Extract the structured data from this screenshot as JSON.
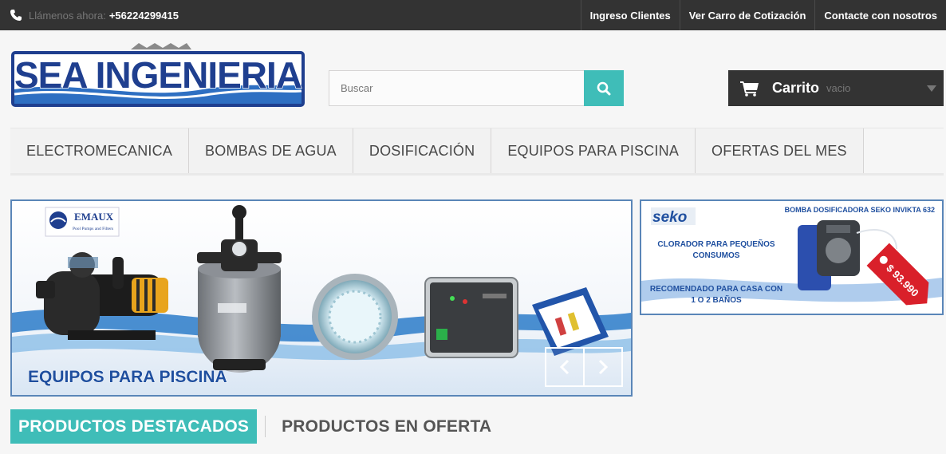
{
  "topbar": {
    "call_label": "Llámenos ahora:",
    "phone": "+56224299415",
    "links": [
      "Ingreso Clientes",
      "Ver Carro de Cotización",
      "Contacte con nosotros"
    ]
  },
  "header": {
    "logo_text": "SEA INGENIERIA",
    "search_placeholder": "Buscar",
    "cart_title": "Carrito",
    "cart_status": "vacio"
  },
  "menu": [
    "ELECTROMECANICA",
    "BOMBAS DE AGUA",
    "DOSIFICACIÓN",
    "EQUIPOS PARA PISCINA",
    "OFERTAS DEL MES"
  ],
  "slider": {
    "brand": "EMAUX",
    "brand_sub": "Pool Pumps and Filters",
    "caption": "EQUIPOS PARA PISCINA"
  },
  "side_banner": {
    "brand": "seko",
    "title": "BOMBA DOSIFICADORA SEKO INVIKTA 632",
    "line1": "CLORADOR PARA PEQUEÑOS",
    "line2": "CONSUMOS",
    "line3": "RECOMENDADO PARA CASA CON",
    "line4": "1 O 2 BAÑOS",
    "price": "$ 93.990"
  },
  "tabs": {
    "active": "PRODUCTOS DESTACADOS",
    "other": "PRODUCTOS EN OFERTA"
  },
  "colors": {
    "accent": "#3fbdb8",
    "dark": "#333333",
    "logo_blue": "#1f3f8f"
  }
}
